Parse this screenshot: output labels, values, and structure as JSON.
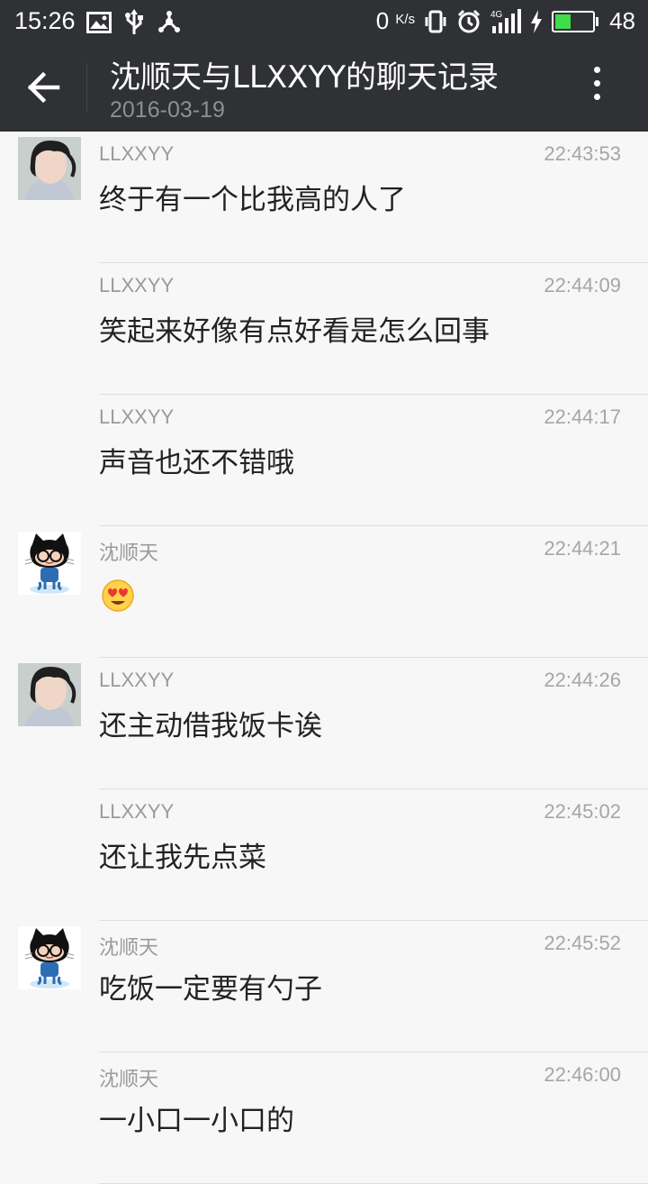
{
  "status_bar": {
    "time": "15:26",
    "net_speed": "0",
    "net_unit": "K/s",
    "network": "4G",
    "battery_level": 48,
    "battery_text": "48"
  },
  "header": {
    "title": "沈顺天与LLXXYY的聊天记录",
    "date": "2016-03-19"
  },
  "messages": [
    {
      "sender": "LLXXYY",
      "time": "22:43:53",
      "text": "终于有一个比我高的人了",
      "avatar": "photo"
    },
    {
      "sender": "LLXXYY",
      "time": "22:44:09",
      "text": "笑起来好像有点好看是怎么回事",
      "avatar": "none"
    },
    {
      "sender": "LLXXYY",
      "time": "22:44:17",
      "text": "声音也还不错哦",
      "avatar": "none"
    },
    {
      "sender": "沈顺天",
      "time": "22:44:21",
      "text": "",
      "avatar": "octocat",
      "emoji": "heart-eyes-emoji"
    },
    {
      "sender": "LLXXYY",
      "time": "22:44:26",
      "text": "还主动借我饭卡诶",
      "avatar": "photo"
    },
    {
      "sender": "LLXXYY",
      "time": "22:45:02",
      "text": "还让我先点菜",
      "avatar": "none"
    },
    {
      "sender": "沈顺天",
      "time": "22:45:52",
      "text": "吃饭一定要有勺子",
      "avatar": "octocat"
    },
    {
      "sender": "沈顺天",
      "time": "22:46:00",
      "text": "一小口一小口的",
      "avatar": "none"
    }
  ]
}
